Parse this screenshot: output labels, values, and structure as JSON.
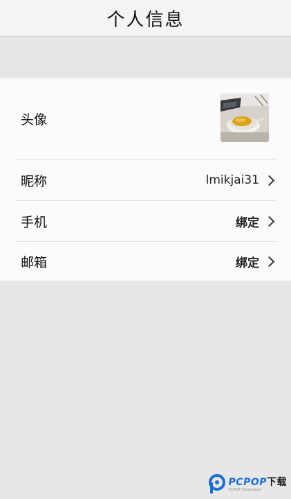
{
  "header": {
    "title": "个人信息"
  },
  "profile": {
    "avatar_label": "头像",
    "nickname_label": "昵称",
    "nickname_value": "lmikjai31",
    "phone_label": "手机",
    "phone_value": "绑定",
    "email_label": "邮箱",
    "email_value": "绑定"
  },
  "icons": {
    "row_arrow": "chevron-right-icon"
  },
  "watermark": {
    "brand_latin": "PCPOP",
    "brand_cn": "下载",
    "subtitle": "PCPOP Download"
  },
  "colors": {
    "page_background": "#e7e7e7",
    "card_background": "#fbfbfb",
    "watermark_blue": "#1a6fd6"
  }
}
